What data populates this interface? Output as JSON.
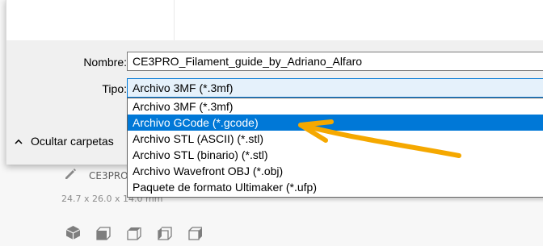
{
  "dialog": {
    "name_label": "Nombre:",
    "name_value": "CE3PRO_Filament_guide_by_Adriano_Alfaro",
    "type_label": "Tipo:",
    "type_value": "Archivo 3MF (*.3mf)",
    "type_options": [
      "Archivo 3MF (*.3mf)",
      "Archivo GCode (*.gcode)",
      "Archivo STL (ASCII) (*.stl)",
      "Archivo STL (binario) (*.stl)",
      "Archivo Wavefront OBJ (*.obj)",
      "Paquete de formato Ultimaker (*.ufp)"
    ],
    "selected_option_index": 1,
    "hide_folders_label": "Ocultar carpetas"
  },
  "background": {
    "model_name": "CE3PRO_",
    "model_dims": "24.7 x 26.0 x 14.0 mm"
  },
  "annotation": {
    "arrow_color": "#f5a800",
    "highlight_color": "#0078d7"
  }
}
